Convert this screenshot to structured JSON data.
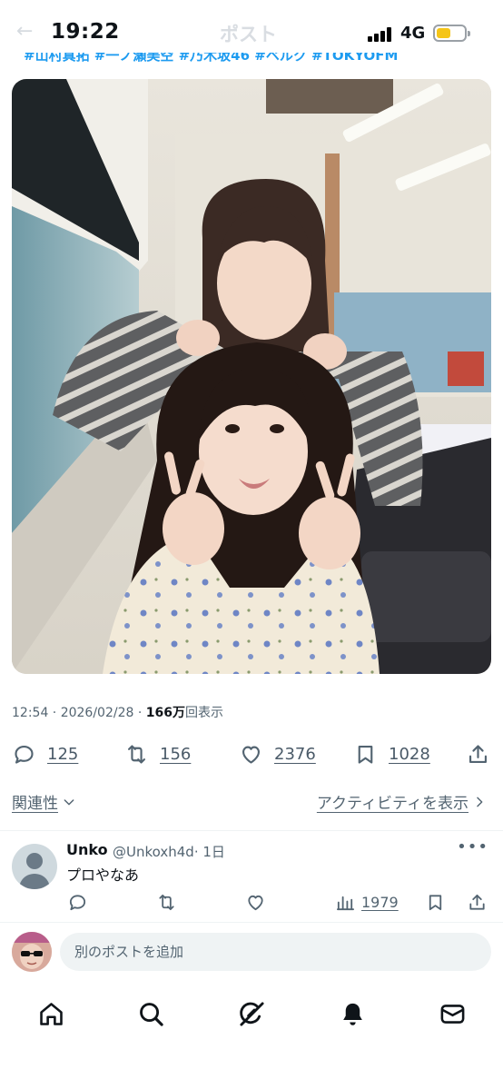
{
  "status_bar": {
    "time": "19:22",
    "network": "4G",
    "battery_level": 0.45,
    "faded_title": "ポスト",
    "faded_back": "←"
  },
  "tweet": {
    "hashtags": "#山村真拓 #一ノ瀬美空 #乃木坂46 #ベルク #TOKYOFM",
    "timestamp": "12:54 · 2026/02/28 · ",
    "views_count": "166万",
    "views_label": "回表示",
    "actions": {
      "replies": "125",
      "reposts": "156",
      "likes": "2376",
      "bookmarks": "1028"
    },
    "sort_label": "関連性",
    "activity_label": "アクティビティを表示"
  },
  "reply": {
    "name": "Unko",
    "handle": "@Unkoxh4d",
    "time": "· 1日",
    "text": "プロやなあ",
    "more": "•••",
    "views": "1979"
  },
  "compose": {
    "placeholder": "別のポストを追加"
  },
  "icons": {
    "reply": "speech-bubble-icon",
    "repost": "repost-arrows-icon",
    "like": "heart-icon",
    "bookmark": "bookmark-icon",
    "share": "share-upload-icon",
    "views": "bar-chart-icon",
    "home": "home-icon",
    "search": "search-icon",
    "grok": "grok-icon",
    "notifications": "bell-icon",
    "messages": "envelope-icon"
  },
  "colors": {
    "accent": "#1d9bf0",
    "secondary_text": "#536471",
    "battery": "#f5c518"
  }
}
